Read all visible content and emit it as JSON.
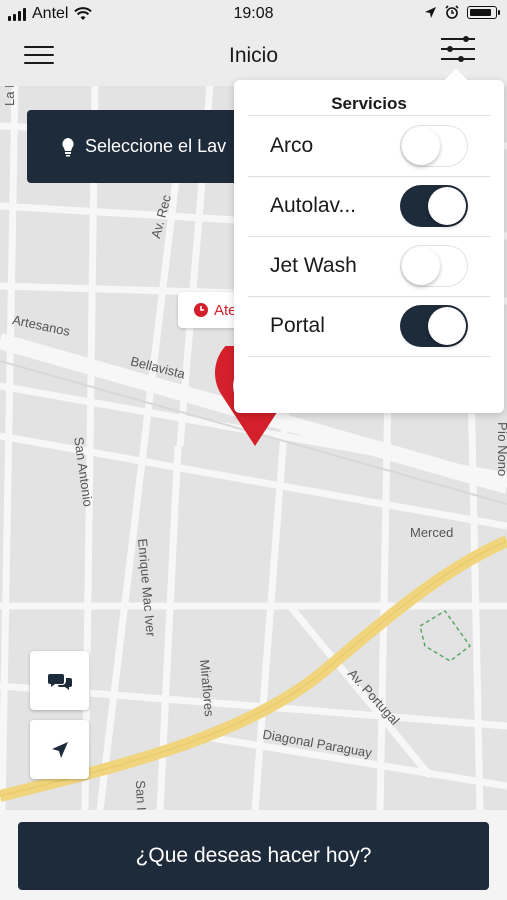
{
  "status_bar": {
    "carrier": "Antel",
    "time": "19:08"
  },
  "nav": {
    "title": "Inicio"
  },
  "banner": {
    "text": "Seleccione el Lav"
  },
  "callout": {
    "text": "Ate"
  },
  "services": {
    "title": "Servicios",
    "items": [
      {
        "label": "Arco",
        "enabled": false
      },
      {
        "label": "Autolav...",
        "enabled": true
      },
      {
        "label": "Jet Wash",
        "enabled": false
      },
      {
        "label": "Portal",
        "enabled": true
      }
    ]
  },
  "map": {
    "streets": [
      "La P",
      "Av. Rec",
      "Artesanos",
      "Bellavista",
      "San Antonio",
      "Enrique Mac Iver",
      "Miraflores",
      "San I",
      "Merced",
      "Av. Portugal",
      "Diagonal Paraguay",
      "Pío Nono"
    ]
  },
  "cta": {
    "label": "¿Que deseas hacer hoy?"
  },
  "colors": {
    "primary": "#1e2b3a",
    "accent_red": "#d4202a"
  }
}
